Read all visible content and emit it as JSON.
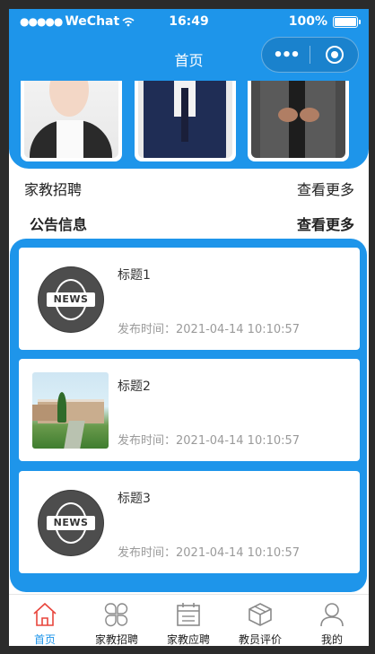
{
  "status_bar": {
    "carrier": "WeChat",
    "time": "16:49",
    "battery": "100%"
  },
  "nav": {
    "title": "首页"
  },
  "sections": {
    "recruit": {
      "label": "家教招聘",
      "more": "查看更多"
    },
    "notice": {
      "label": "公告信息",
      "more": "查看更多"
    }
  },
  "announcements": [
    {
      "title": "标题1",
      "time": "发布时间：2021-04-14 10:10:57",
      "thumb": "news-icon",
      "thumb_text": "NEWS"
    },
    {
      "title": "标题2",
      "time": "发布时间：2021-04-14 10:10:57",
      "thumb": "school-photo"
    },
    {
      "title": "标题3",
      "time": "发布时间：2021-04-14 10:10:57",
      "thumb": "news-icon",
      "thumb_text": "NEWS"
    }
  ],
  "tabbar": [
    {
      "label": "首页",
      "icon": "home-icon",
      "active": true
    },
    {
      "label": "家教招聘",
      "icon": "grid-icon",
      "active": false
    },
    {
      "label": "家教应聘",
      "icon": "calendar-icon",
      "active": false
    },
    {
      "label": "教员评价",
      "icon": "box-icon",
      "active": false
    },
    {
      "label": "我的",
      "icon": "user-icon",
      "active": false
    }
  ],
  "colors": {
    "primary": "#1e95ea",
    "active_tab": "#e8453c",
    "inactive_icon": "#8a8a8a"
  }
}
